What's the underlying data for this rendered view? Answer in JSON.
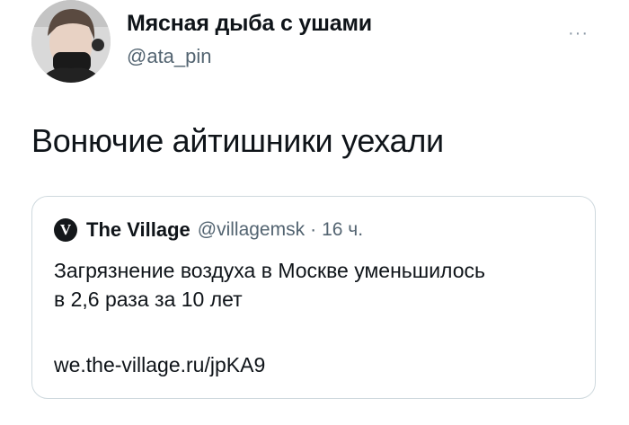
{
  "author": {
    "display_name": "Мясная дыба с ушами",
    "handle": "@ata_pin",
    "avatar_icon": "user-avatar-photo"
  },
  "more_label": "···",
  "tweet": {
    "text": "Вонючие айтишники уехали"
  },
  "quote": {
    "logo_letter": "V",
    "name": "The Village",
    "handle": "@villagemsk",
    "separator": "·",
    "time": "16 ч.",
    "text_lines": [
      "Загрязнение воздуха в Москве уменьшилось",
      "в 2,6 раза за 10 лет"
    ],
    "link": "we.the-village.ru/jpKA9"
  }
}
